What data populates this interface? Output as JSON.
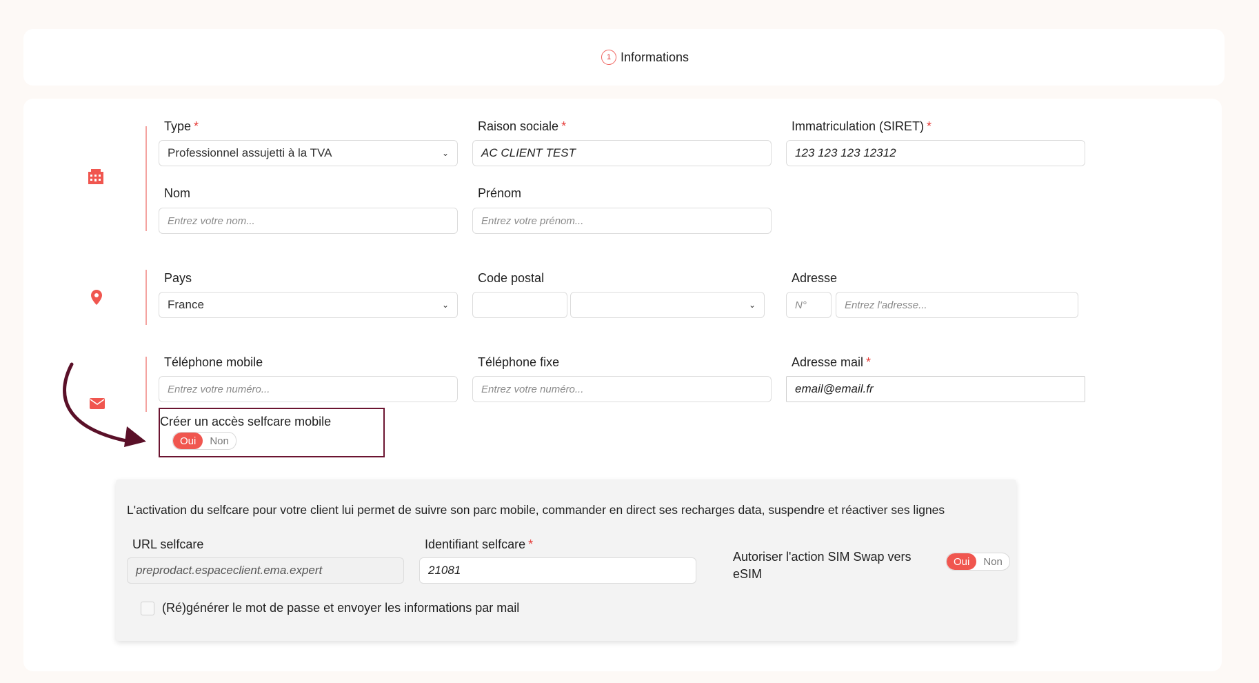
{
  "step": {
    "number": "1",
    "label": "Informations"
  },
  "company": {
    "type": {
      "label": "Type",
      "value": "Professionnel assujetti à la TVA"
    },
    "raison_sociale": {
      "label": "Raison sociale",
      "value": "AC CLIENT TEST"
    },
    "siret": {
      "label": "Immatriculation (SIRET)",
      "value": "123 123 123 12312"
    },
    "nom": {
      "label": "Nom",
      "placeholder": "Entrez votre nom..."
    },
    "prenom": {
      "label": "Prénom",
      "placeholder": "Entrez votre prénom..."
    }
  },
  "address": {
    "pays": {
      "label": "Pays",
      "value": "France"
    },
    "code_postal": {
      "label": "Code postal",
      "value": "",
      "city": ""
    },
    "adresse": {
      "label": "Adresse",
      "num_placeholder": "N°",
      "placeholder": "Entrez l'adresse..."
    }
  },
  "contact": {
    "mobile": {
      "label": "Téléphone mobile",
      "placeholder": "Entrez votre numéro..."
    },
    "fixe": {
      "label": "Téléphone fixe",
      "placeholder": "Entrez votre numéro..."
    },
    "email": {
      "label": "Adresse mail",
      "value": "email@email.fr"
    }
  },
  "selfcare_toggle": {
    "label": "Créer un accès selfcare mobile",
    "on": "Oui",
    "off": "Non",
    "selected": "Oui"
  },
  "selfcare": {
    "description": "L'activation du selfcare pour votre client lui permet de suivre son parc mobile, commander en direct ses recharges data, suspendre et réactiver ses lignes",
    "url": {
      "label": "URL selfcare",
      "value": "preprodact.espaceclient.ema.expert"
    },
    "identifiant": {
      "label": "Identifiant selfcare",
      "value": "21081"
    },
    "sim_swap": {
      "label": "Autoriser l'action SIM Swap vers eSIM",
      "on": "Oui",
      "off": "Non",
      "selected": "Oui"
    },
    "regenerate": {
      "label": "(Ré)générer le mot de passe et envoyer les informations par mail",
      "checked": false
    }
  },
  "colors": {
    "accent": "#f0564f",
    "highlight_border": "#6b1430"
  }
}
